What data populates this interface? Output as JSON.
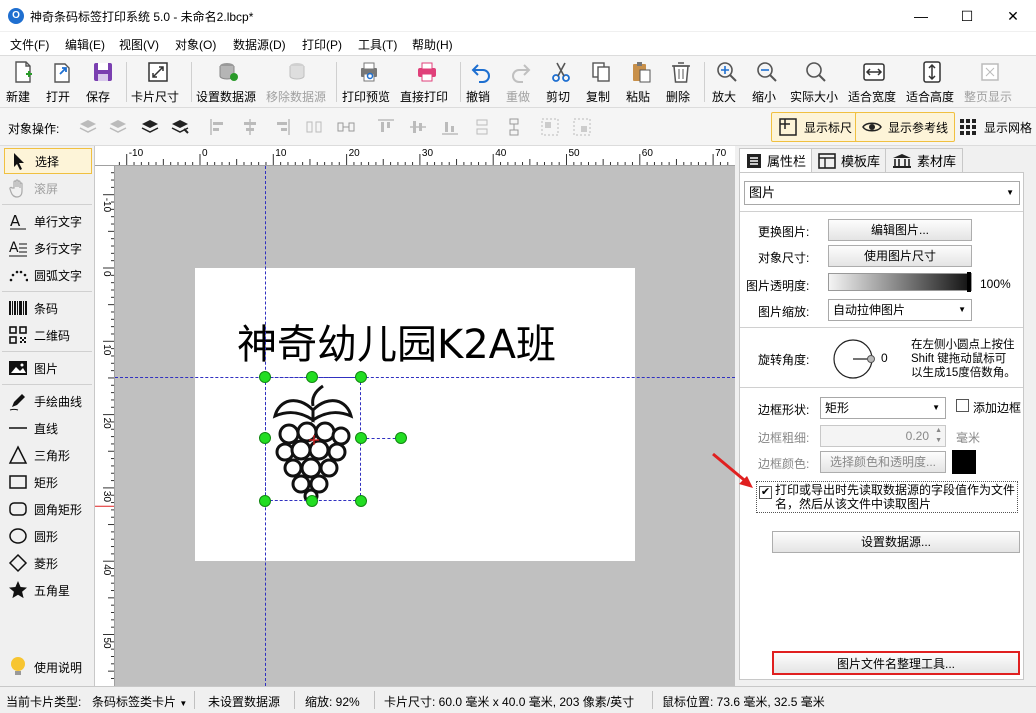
{
  "window": {
    "title": "神奇条码标签打印系统 5.0 - 未命名2.lbcp*",
    "minimize": "—",
    "maximize": "☐",
    "close": "✕"
  },
  "menu": [
    "文件(F)",
    "编辑(E)",
    "视图(V)",
    "对象(O)",
    "数据源(D)",
    "打印(P)",
    "工具(T)",
    "帮助(H)"
  ],
  "toolbar": {
    "new": "新建",
    "open": "打开",
    "save": "保存",
    "card_size": "卡片尺寸",
    "set_datasource": "设置数据源",
    "remove_datasource": "移除数据源",
    "print_preview": "打印预览",
    "direct_print": "直接打印",
    "undo": "撤销",
    "redo": "重做",
    "cut": "剪切",
    "copy": "复制",
    "paste": "粘贴",
    "delete": "删除",
    "zoom_in": "放大",
    "zoom_out": "缩小",
    "actual_size": "实际大小",
    "fit_width": "适合宽度",
    "fit_height": "适合高度",
    "whole_page": "整页显示"
  },
  "objbar": {
    "label": "对象操作:",
    "show_ruler": "显示标尺",
    "show_guides": "显示参考线",
    "show_grid": "显示网格"
  },
  "tools": {
    "select": "选择",
    "scroll": "滚屏",
    "single_text": "单行文字",
    "multi_text": "多行文字",
    "arc_text": "圆弧文字",
    "barcode": "条码",
    "qrcode": "二维码",
    "image": "图片",
    "freehand": "手绘曲线",
    "line": "直线",
    "triangle": "三角形",
    "rect": "矩形",
    "round_rect": "圆角矩形",
    "ellipse": "圆形",
    "diamond": "菱形",
    "star": "五角星",
    "help": "使用说明"
  },
  "ruler": {
    "top": [
      "-10",
      "0",
      "10",
      "20",
      "30",
      "40",
      "50",
      "60",
      "70"
    ],
    "left": [
      "-10",
      "0",
      "10",
      "20",
      "30",
      "40",
      "50"
    ]
  },
  "canvas": {
    "label_text": "神奇幼儿园K2A班"
  },
  "rpanel": {
    "tabs": [
      "属性栏",
      "模板库",
      "素材库"
    ],
    "object_type": "图片",
    "change_image": "更换图片:",
    "edit_image": "编辑图片...",
    "object_size": "对象尺寸:",
    "use_image_size": "使用图片尺寸",
    "opacity_label": "图片透明度:",
    "opacity_value": "100%",
    "opacity_fraction": 1.0,
    "scale_label": "图片缩放:",
    "scale_value": "自动拉伸图片",
    "rotation_label": "旋转角度:",
    "rotation_value": "0",
    "rotation_hint_1": "在左侧小圆点上按住",
    "rotation_hint_2": "Shift 键拖动鼠标可",
    "rotation_hint_3": "以生成15度倍数角。",
    "border_shape_label": "边框形状:",
    "border_shape_value": "矩形",
    "add_border": "添加边框",
    "border_width_label": "边框粗细:",
    "border_width_value": "0.20",
    "border_width_unit": "毫米",
    "border_color_label": "边框颜色:",
    "choose_color": "选择颜色和透明度...",
    "border_color": "#000000",
    "read_from_field_line1": "打印或导出时先读取数据源的字段值作为文件",
    "read_from_field_line2": "名，然后从该文件中读取图片",
    "read_from_field_checked": true,
    "set_datasource_btn": "设置数据源...",
    "filename_tool_btn": "图片文件名整理工具..."
  },
  "status": {
    "card_type_label": "当前卡片类型:",
    "card_type_value": "条码标签类卡片",
    "datasource": "未设置数据源",
    "zoom": "缩放: 92%",
    "card_size": "卡片尺寸: 60.0 毫米 x 40.0 毫米, 203 像素/英寸",
    "mouse_pos": "鼠标位置: 73.6 毫米, 32.5 毫米"
  },
  "colors": {
    "accent_red": "#e02020",
    "handle_green": "#22dd22",
    "guide_blue": "#3030c0"
  }
}
